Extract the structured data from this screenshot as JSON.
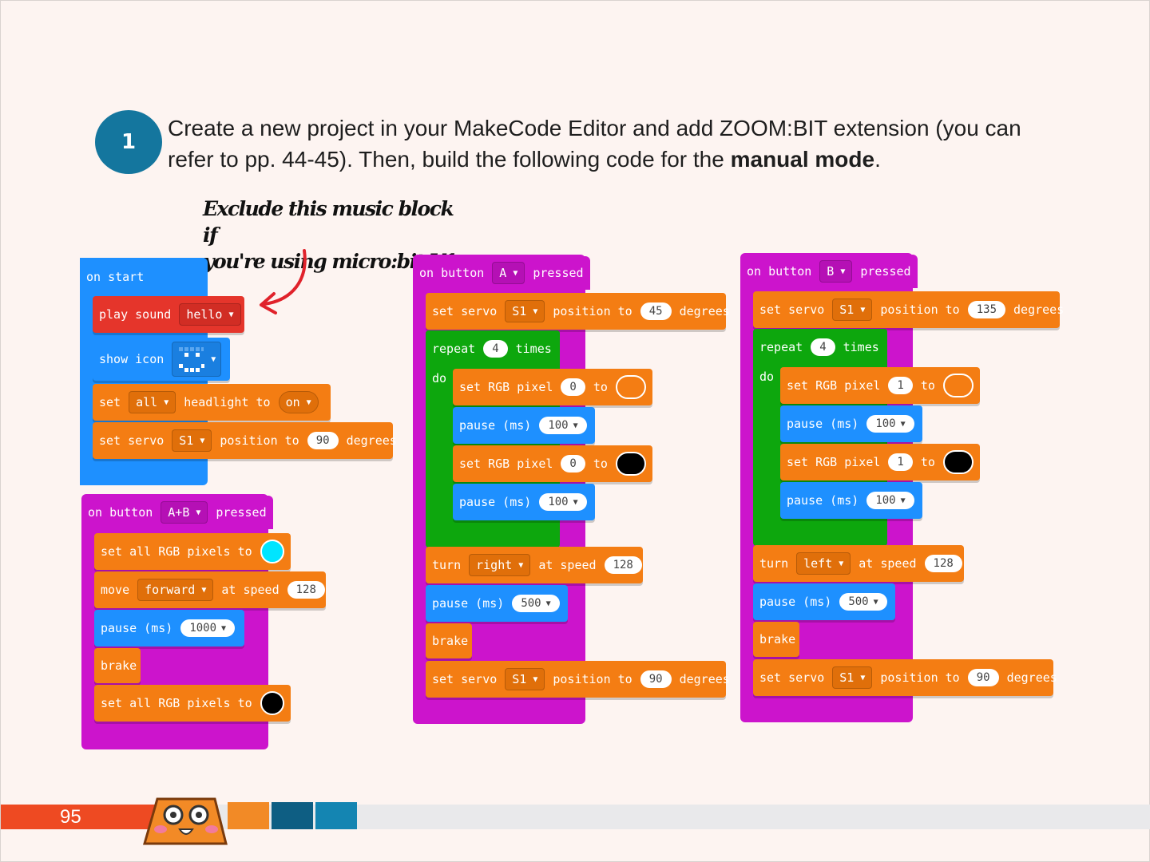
{
  "step": {
    "number": "1",
    "text_part1": "Create a new project in your MakeCode Editor and add ZOOM:BIT extension (you can refer to pp. 44-45). Then, build the following code for the ",
    "text_bold": "manual mode",
    "text_end": "."
  },
  "note": {
    "line1": "Exclude this music block if",
    "line2": "you're using micro:bit V1."
  },
  "on_start": {
    "hat": "on start",
    "play": "play sound",
    "play_value": "hello",
    "show_icon": "show icon",
    "set": "set",
    "set_value": "all",
    "headlight": "headlight to",
    "headlight_value": "on",
    "servo": "set servo",
    "servo_value": "S1",
    "position": "position to",
    "position_value": "90",
    "degrees": "degrees"
  },
  "on_ab": {
    "hat_prefix": "on button",
    "button": "A+B",
    "hat_suffix": "pressed",
    "set_all": "set all RGB pixels to",
    "color1": "#00e5ff",
    "move": "move",
    "move_dir": "forward",
    "at_speed": "at speed",
    "speed": "128",
    "pause": "pause (ms)",
    "pause_value": "1000",
    "brake": "brake",
    "color2": "#000000"
  },
  "on_a": {
    "hat_prefix": "on button",
    "button": "A",
    "hat_suffix": "pressed",
    "servo": "set servo",
    "servo_value": "S1",
    "position": "position to",
    "position1": "45",
    "degrees": "degrees",
    "repeat": "repeat",
    "repeat_count": "4",
    "times": "times",
    "do": "do",
    "set_pixel": "set RGB pixel",
    "pixel": "0",
    "to": "to",
    "pixel_color1": "#f47d13",
    "pixel_color2": "#000000",
    "pause": "pause (ms)",
    "pause_inner": "100",
    "turn": "turn",
    "turn_dir": "right",
    "at_speed": "at speed",
    "speed": "128",
    "pause_outer": "500",
    "brake": "brake",
    "position2": "90"
  },
  "on_b": {
    "hat_prefix": "on button",
    "button": "B",
    "hat_suffix": "pressed",
    "servo": "set servo",
    "servo_value": "S1",
    "position": "position to",
    "position1": "135",
    "degrees": "degrees",
    "repeat": "repeat",
    "repeat_count": "4",
    "times": "times",
    "do": "do",
    "set_pixel": "set RGB pixel",
    "pixel": "1",
    "to": "to",
    "pixel_color1": "#f47d13",
    "pixel_color2": "#000000",
    "pause": "pause (ms)",
    "pause_inner": "100",
    "turn": "turn",
    "turn_dir": "left",
    "at_speed": "at speed",
    "speed": "128",
    "pause_outer": "500",
    "brake": "brake",
    "position2": "90"
  },
  "footer": {
    "page_number": "95",
    "colors": [
      "#f28a26",
      "#0e5e83",
      "#1485b2"
    ]
  }
}
